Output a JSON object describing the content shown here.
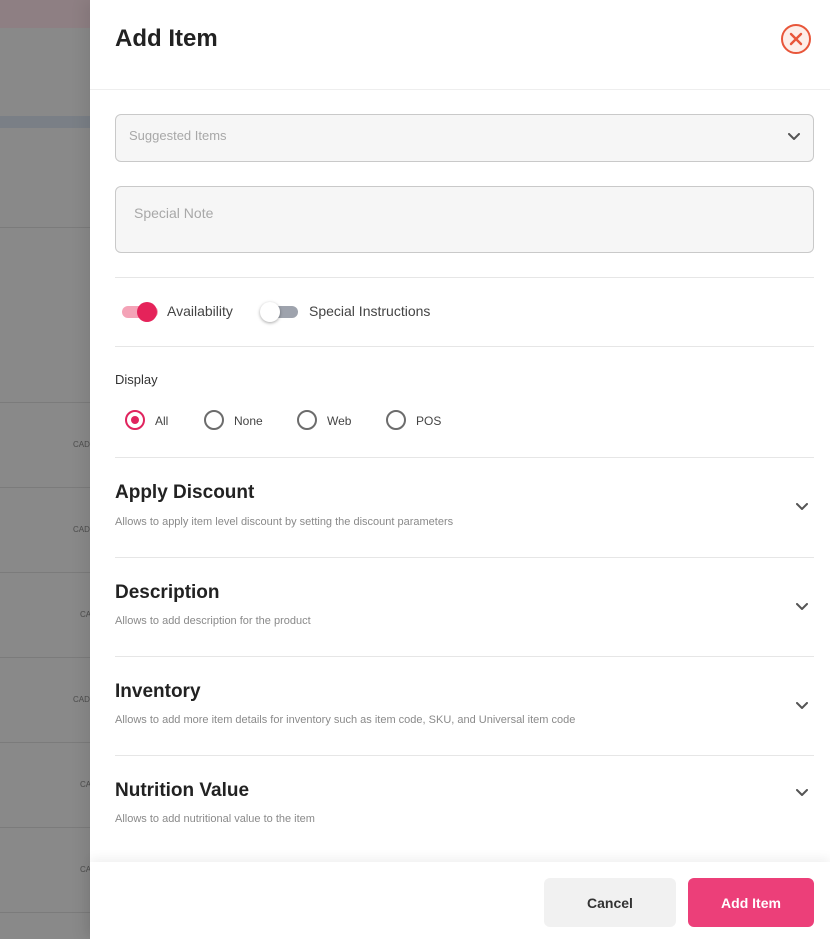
{
  "backdrop": {
    "row_labels": [
      "CAD",
      "CAD",
      "CA",
      "CAD",
      "CA",
      "CA"
    ]
  },
  "drawer": {
    "title": "Add Item",
    "close_icon": "close-icon"
  },
  "form": {
    "suggested_items": {
      "placeholder": "Suggested Items",
      "value": ""
    },
    "special_note": {
      "placeholder": "Special Note",
      "value": ""
    },
    "toggles": [
      {
        "label": "Availability",
        "checked": true
      },
      {
        "label": "Special Instructions",
        "checked": false
      }
    ],
    "display": {
      "label": "Display",
      "options": [
        "All",
        "None",
        "Web",
        "POS"
      ],
      "selected": "All"
    }
  },
  "sections": [
    {
      "title": "Apply Discount",
      "subtitle": "Allows to apply item level discount by setting the discount parameters"
    },
    {
      "title": "Description",
      "subtitle": "Allows to add description for the product"
    },
    {
      "title": "Inventory",
      "subtitle": "Allows to add more item details for inventory such as item code, SKU, and Universal item code"
    },
    {
      "title": "Nutrition Value",
      "subtitle": "Allows to add nutritional value to the item"
    }
  ],
  "footer": {
    "cancel_label": "Cancel",
    "add_label": "Add Item"
  },
  "colors": {
    "accent": "#e5235a",
    "primary_button": "#ec3f79",
    "close_icon": "#e8563a"
  }
}
